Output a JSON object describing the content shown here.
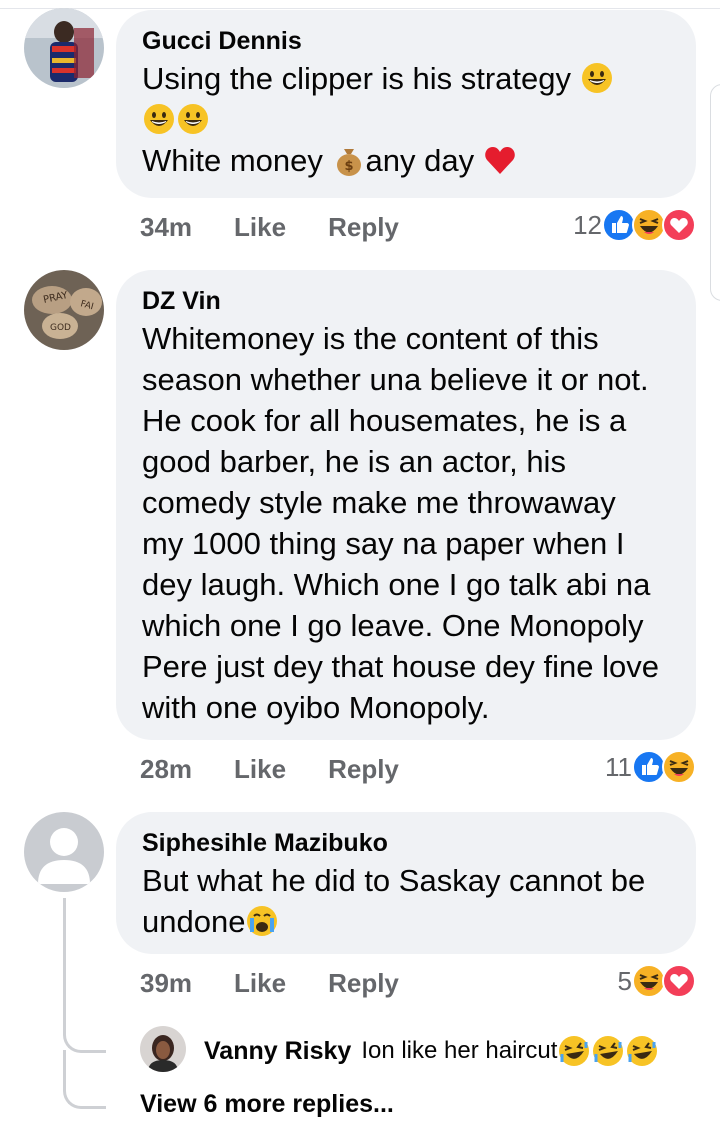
{
  "comments": [
    {
      "author": "Gucci Dennis",
      "lines": [
        "Using the clipper is his strategy",
        "",
        "White money",
        "any day"
      ],
      "time": "34m",
      "like_label": "Like",
      "reply_label": "Reply",
      "reaction_count": "12",
      "reaction_icons": [
        "like-icon",
        "haha-icon",
        "love-icon"
      ]
    },
    {
      "author": "DZ Vin",
      "lines": [
        "Whitemoney is the content of this",
        "season whether una believe it or not.",
        "He cook for all housemates, he is a",
        "good barber, he is an actor, his",
        "comedy style make me throwaway",
        "my 1000 thing say na paper when I",
        "dey laugh. Which one I go talk abi na",
        "which one I go leave. One Monopoly",
        "Pere just dey that house dey fine love",
        "with one oyibo Monopoly."
      ],
      "time": "28m",
      "like_label": "Like",
      "reply_label": "Reply",
      "reaction_count": "11",
      "reaction_icons": [
        "like-icon",
        "haha-icon"
      ]
    },
    {
      "author": "Siphesihle Mazibuko",
      "lines": [
        "But what he did to Saskay cannot be",
        "undone"
      ],
      "time": "39m",
      "like_label": "Like",
      "reply_label": "Reply",
      "reaction_count": "5",
      "reaction_icons": [
        "haha-icon",
        "love-icon"
      ]
    }
  ],
  "reply": {
    "author": "Vanny Risky",
    "text": "Ion like her haircut"
  },
  "view_more": "View 6 more replies...",
  "colors": {
    "bubble": "#f0f2f5",
    "meta": "#65676b",
    "like_blue": "#1877f2",
    "love_red": "#f33e58",
    "haha_yellow": "#f7b125"
  }
}
